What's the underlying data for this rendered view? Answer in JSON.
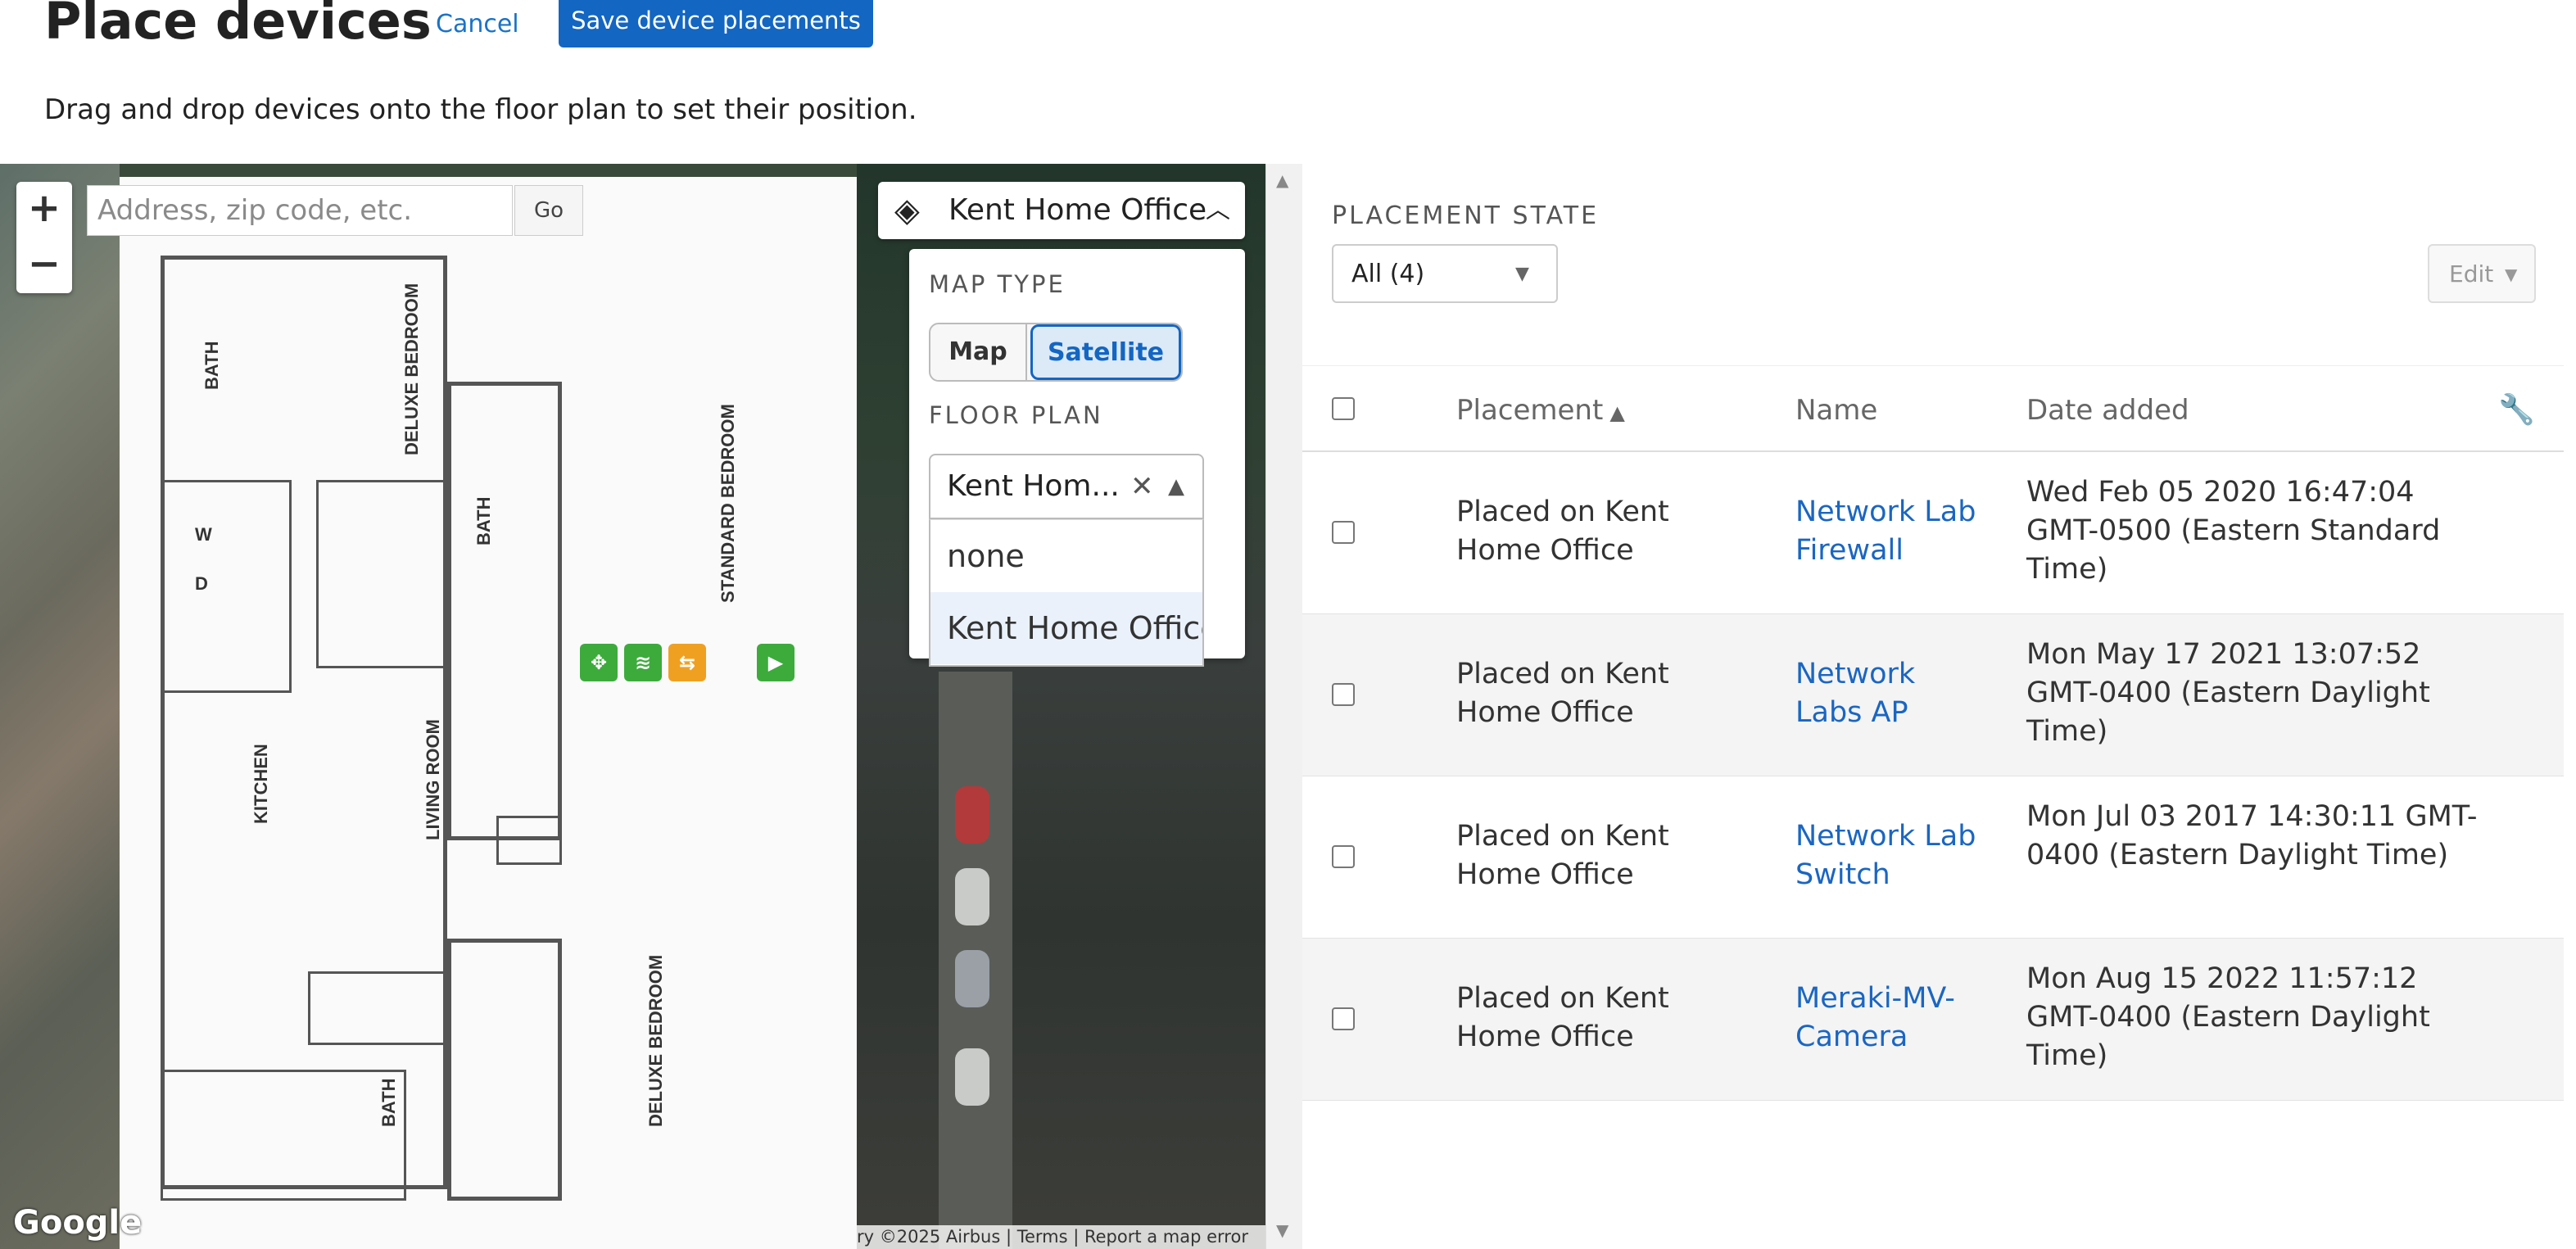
{
  "header": {
    "title": "Place devices",
    "cancel_label": "Cancel",
    "save_label": "Save device placements",
    "subtitle": "Drag and drop devices onto the floor plan to set their position."
  },
  "map": {
    "zoom_in": "+",
    "zoom_out": "−",
    "search_placeholder": "Address, zip code, etc.",
    "go_label": "Go",
    "layer_icon": "layers-icon",
    "layer_label": "Kent Home Office",
    "map_type_heading": "MAP TYPE",
    "map_type_options": [
      "Map",
      "Satellite"
    ],
    "map_type_selected": "Satellite",
    "floor_plan_heading": "FLOOR PLAN",
    "floor_plan_selected": "Kent Hom...",
    "floor_plan_options": [
      "none",
      "Kent Home Office"
    ],
    "hidden_heading_fragment": "TY",
    "attribution": "ry ©2025 Airbus  |  Terms  |  Report a map error",
    "google_logo": "Google",
    "floorplan_labels": [
      "BATH",
      "DELUXE BEDROOM",
      "BATH",
      "STANDARD BEDROOM",
      "KITCHEN",
      "LIVING ROOM",
      "BATH",
      "DELUXE BEDROOM",
      "W",
      "D"
    ]
  },
  "placement": {
    "state_label": "PLACEMENT STATE",
    "state_value": "All (4)",
    "edit_label": "Edit"
  },
  "table": {
    "columns": [
      "Placement",
      "Name",
      "Date added"
    ],
    "sort_indicator": "▲",
    "rows": [
      {
        "placement": "Placed on Kent Home Office",
        "name": "Network Lab Firewall",
        "date": "Wed Feb 05 2020 16:47:04 GMT-0500 (Eastern Standard Time)"
      },
      {
        "placement": "Placed on Kent Home Office",
        "name": "Network Labs AP",
        "date": "Mon May 17 2021 13:07:52 GMT-0400 (Eastern Daylight Time)"
      },
      {
        "placement": "Placed on Kent Home Office",
        "name": "Network Lab Switch",
        "date": "Mon Jul 03 2017 14:30:11 GMT-0400 (Eastern Daylight Time)"
      },
      {
        "placement": "Placed on Kent Home Office",
        "name": "Meraki-MV-Camera",
        "date": "Mon Aug 15 2022 11:57:12 GMT-0400 (Eastern Daylight Time)"
      }
    ]
  },
  "colors": {
    "primary": "#1366c2",
    "marker_green": "#3cab3c",
    "marker_orange": "#f0a020"
  }
}
